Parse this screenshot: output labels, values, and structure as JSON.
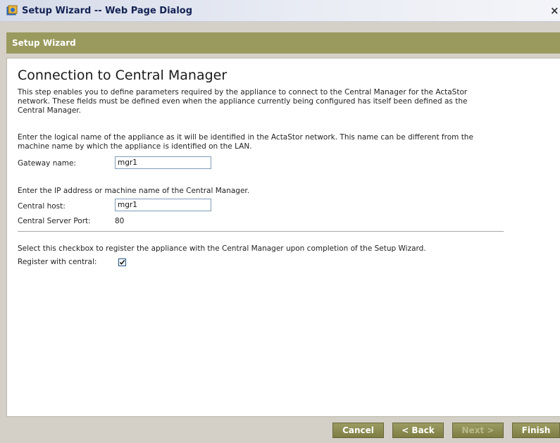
{
  "window": {
    "title": "Setup Wizard -- Web Page Dialog",
    "close_glyph": "×"
  },
  "band": {
    "title": "Setup Wizard"
  },
  "page": {
    "heading": "Connection to Central Manager",
    "intro_lines": [
      "This step enables you to define parameters required by the appliance to connect to the Central Manager for the ActaStor",
      "network. These fields must be defined even when the appliance currently being configured has itself been defined as the",
      "Central Manager."
    ],
    "gateway_help_lines": [
      "Enter the logical name of the appliance as it will be identified in the ActaStor network. This name can be different from the",
      "machine name by which the appliance is identified on the LAN."
    ],
    "gateway_label": "Gateway name:",
    "gateway_value": "mgr1",
    "host_help": "Enter the IP address or machine name of the Central Manager.",
    "host_label": "Central host:",
    "host_value": "mgr1",
    "port_label": "Central Server Port:",
    "port_value": "80",
    "register_help": "Select this checkbox to register the appliance with the Central Manager upon completion of the Setup Wizard.",
    "register_label": "Register with central:",
    "register_checked": true
  },
  "buttons": {
    "cancel": "Cancel",
    "back": "< Back",
    "next": "Next >",
    "finish": "Finish"
  }
}
